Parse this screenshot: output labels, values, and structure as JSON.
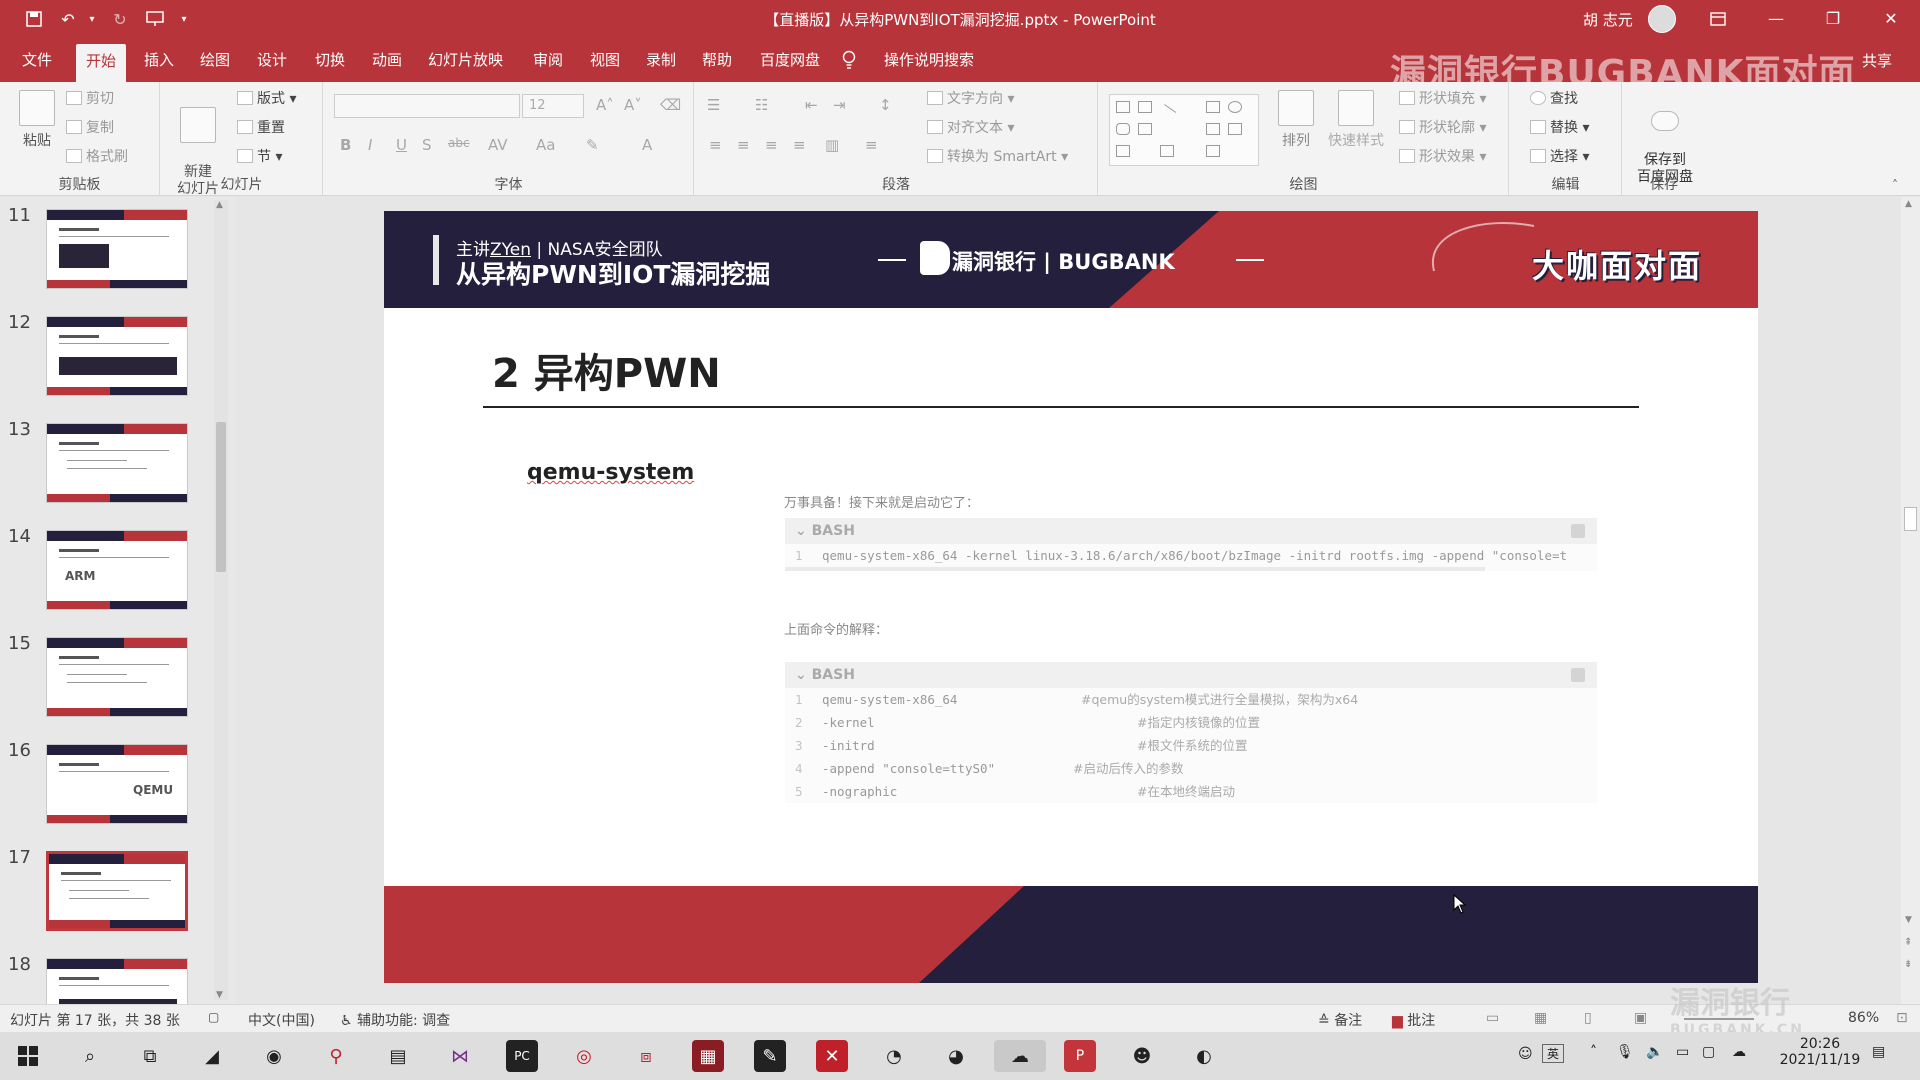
{
  "window": {
    "title": "【直播版】从异构PWN到IOT漏洞挖掘.pptx  -  PowerPoint",
    "user": "胡 志元"
  },
  "ribbon": {
    "tabs": [
      "文件",
      "开始",
      "插入",
      "绘图",
      "设计",
      "切换",
      "动画",
      "幻灯片放映",
      "审阅",
      "视图",
      "录制",
      "帮助",
      "百度网盘"
    ],
    "tell_me": "操作说明搜索",
    "share": "共享",
    "watermark": "漏洞银行BUGBANK面对面",
    "clipboard": {
      "paste": "粘贴",
      "cut": "剪切",
      "copy": "复制",
      "format_painter": "格式刷",
      "label": "剪贴板"
    },
    "slides": {
      "new_slide": "新建\n幻灯片",
      "layout": "版式",
      "reset": "重置",
      "section": "节",
      "label": "幻灯片"
    },
    "font": {
      "size": "12",
      "label": "字体"
    },
    "paragraph": {
      "text_direction": "文字方向",
      "align_text": "对齐文本",
      "smartart": "转换为 SmartArt",
      "label": "段落"
    },
    "drawing": {
      "arrange": "排列",
      "quick_styles": "快速样式",
      "shape_fill": "形状填充",
      "shape_outline": "形状轮廓",
      "shape_effects": "形状效果",
      "label": "绘图"
    },
    "editing": {
      "find": "查找",
      "replace": "替换",
      "select": "选择",
      "label": "编辑"
    },
    "save": {
      "save_to": "保存到\n百度网盘",
      "label": "保存"
    }
  },
  "thumbnails": [
    {
      "num": "11",
      "kind": "dark-block"
    },
    {
      "num": "12",
      "kind": "dark-bar"
    },
    {
      "num": "13",
      "kind": "text"
    },
    {
      "num": "14",
      "kind": "arm",
      "label": "ARM"
    },
    {
      "num": "15",
      "kind": "text"
    },
    {
      "num": "16",
      "kind": "qemu",
      "label": "QEMU"
    },
    {
      "num": "17",
      "kind": "text",
      "selected": true
    },
    {
      "num": "18",
      "kind": "dark-bar"
    }
  ],
  "slide": {
    "header_sub_prefix": "主讲",
    "header_sub_name": "ZYen",
    "header_sub_suffix": " | NASA安全团队",
    "header_title": "从异构PWN到IOT漏洞挖掘",
    "badge": "大咖面对面",
    "section_title": "2 异构PWN",
    "topic": "qemu-system",
    "para1": "万事具备！接下来就是启动它了：",
    "code1_lang": "BASH",
    "code1_lines": [
      {
        "num": "1",
        "cmd": "qemu-system-x86_64 -kernel linux-3.18.6/arch/x86/boot/bzImage -initrd rootfs.img -append \"console=t"
      }
    ],
    "para2": "上面命令的解释：",
    "code2_lang": "BASH",
    "code2_lines": [
      {
        "num": "1",
        "cmd": "qemu-system-x86_64",
        "comment": "#qemu的system模式进行全量模拟，架构为x64"
      },
      {
        "num": "2",
        "cmd": "-kernel",
        "comment": "#指定内核镜像的位置"
      },
      {
        "num": "3",
        "cmd": "-initrd",
        "comment": "#根文件系统的位置"
      },
      {
        "num": "4",
        "cmd": "-append \"console=ttyS0\"",
        "comment": "#启动后传入的参数"
      },
      {
        "num": "5",
        "cmd": "-nographic",
        "comment": "#在本地终端启动"
      }
    ],
    "footer_brand": "漏洞银行 | BUGBANK"
  },
  "status": {
    "slide_info": "幻灯片 第 17 张，共 38 张",
    "language": "中文(中国)",
    "accessibility": "辅助功能: 调查",
    "notes": "备注",
    "comments": "批注",
    "zoom": "86%",
    "watermark_main": "漏洞银行",
    "watermark_sub": "BUGBANK.CN"
  },
  "taskbar": {
    "time": "20:26",
    "date": "2021/11/19",
    "ime": "英"
  },
  "colors": {
    "accent": "#b7343a",
    "dark": "#241f3c"
  }
}
